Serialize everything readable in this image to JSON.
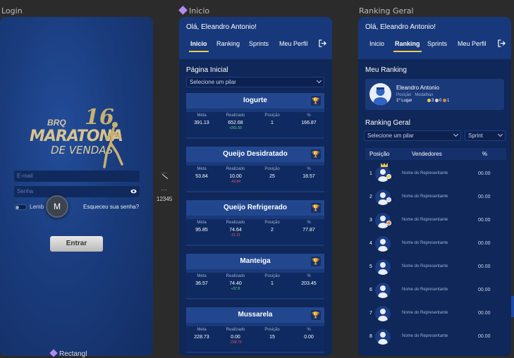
{
  "frames": {
    "login_label": "Login",
    "inicio_label": "Inicio",
    "ranking_label": "Ranking Geral",
    "bottom_label": "Rectangl"
  },
  "login": {
    "logo": {
      "brand": "BRQ",
      "line1": "MARATONA",
      "line2": "DE VENDAS",
      "edition": "16"
    },
    "email_placeholder": "E-mail",
    "password_placeholder": "Senha",
    "remember_label": "Lemb",
    "forgot_label": "Esqueceu sua senha?",
    "avatar_letter": "M",
    "submit_label": "Entrar"
  },
  "misc": {
    "code": "12345"
  },
  "inicio": {
    "greeting": "Olá, Eleandro Antonio!",
    "tabs": [
      "Inicio",
      "Ranking",
      "Sprints",
      "Meu Perfil"
    ],
    "page_title": "Página Inicial",
    "pilar_select": "Selecione um pilar",
    "column_labels": [
      "Meta",
      "Realizado",
      "Posição",
      "%"
    ],
    "cards": [
      {
        "name": "Iogurte",
        "meta": "391.13",
        "realizado": "652.68",
        "delta": "+261.55",
        "delta_type": "pos",
        "posicao": "1",
        "pct": "166.87"
      },
      {
        "name": "Queijo Desidratado",
        "meta": "53.84",
        "realizado": "10.00",
        "delta": "-43.84",
        "delta_type": "neg",
        "posicao": "25",
        "pct": "18.57"
      },
      {
        "name": "Queijo Refrigerado",
        "meta": "95.85",
        "realizado": "74.64",
        "delta": "-21.21",
        "delta_type": "neg",
        "posicao": "2",
        "pct": "77.87"
      },
      {
        "name": "Manteiga",
        "meta": "36.57",
        "realizado": "74.40",
        "delta": "+37.8",
        "delta_type": "pos",
        "posicao": "1",
        "pct": "203.45"
      },
      {
        "name": "Mussarela",
        "meta": "228.73",
        "realizado": "0.00",
        "delta": "-228.73",
        "delta_type": "neg",
        "posicao": "15",
        "pct": "0.00"
      }
    ]
  },
  "ranking": {
    "greeting": "Olá, Eleandro Antonio!",
    "tabs": [
      "Inicio",
      "Ranking",
      "Sprints",
      "Meu Perfil"
    ],
    "meu_title": "Meu Ranking",
    "meu": {
      "name": "Eleandro Antonio",
      "posicao_label": "Posição",
      "medalhas_label": "Medalhas",
      "posicao": "1º Lugar",
      "gold": "3",
      "silver": "0",
      "bronze": "1"
    },
    "geral_title": "Ranking Geral",
    "pilar_select": "Selecione um pilar",
    "sprint_select": "Sprint",
    "headers": {
      "posicao": "Posição",
      "vendedores": "Vendedores",
      "pct": "%"
    },
    "rows": [
      {
        "pos": "1",
        "name": "Nome do Representante",
        "score": "00.00"
      },
      {
        "pos": "2",
        "name": "Nome do Representante",
        "score": "00.00"
      },
      {
        "pos": "3",
        "name": "Nome do Representante",
        "score": "00.00"
      },
      {
        "pos": "4",
        "name": "Nome do Representante",
        "score": "00.00"
      },
      {
        "pos": "5",
        "name": "Nome do Representante",
        "score": "00.00"
      },
      {
        "pos": "6",
        "name": "Nome do Representante",
        "score": "00.00"
      },
      {
        "pos": "7",
        "name": "Nome do Representante",
        "score": "00.00"
      },
      {
        "pos": "8",
        "name": "Nome do Representante",
        "score": "00.00"
      }
    ]
  },
  "colors": {
    "accent": "#f2c94c",
    "panel": "#15306b",
    "positive": "#5bd68b",
    "negative": "#e05b5b"
  }
}
